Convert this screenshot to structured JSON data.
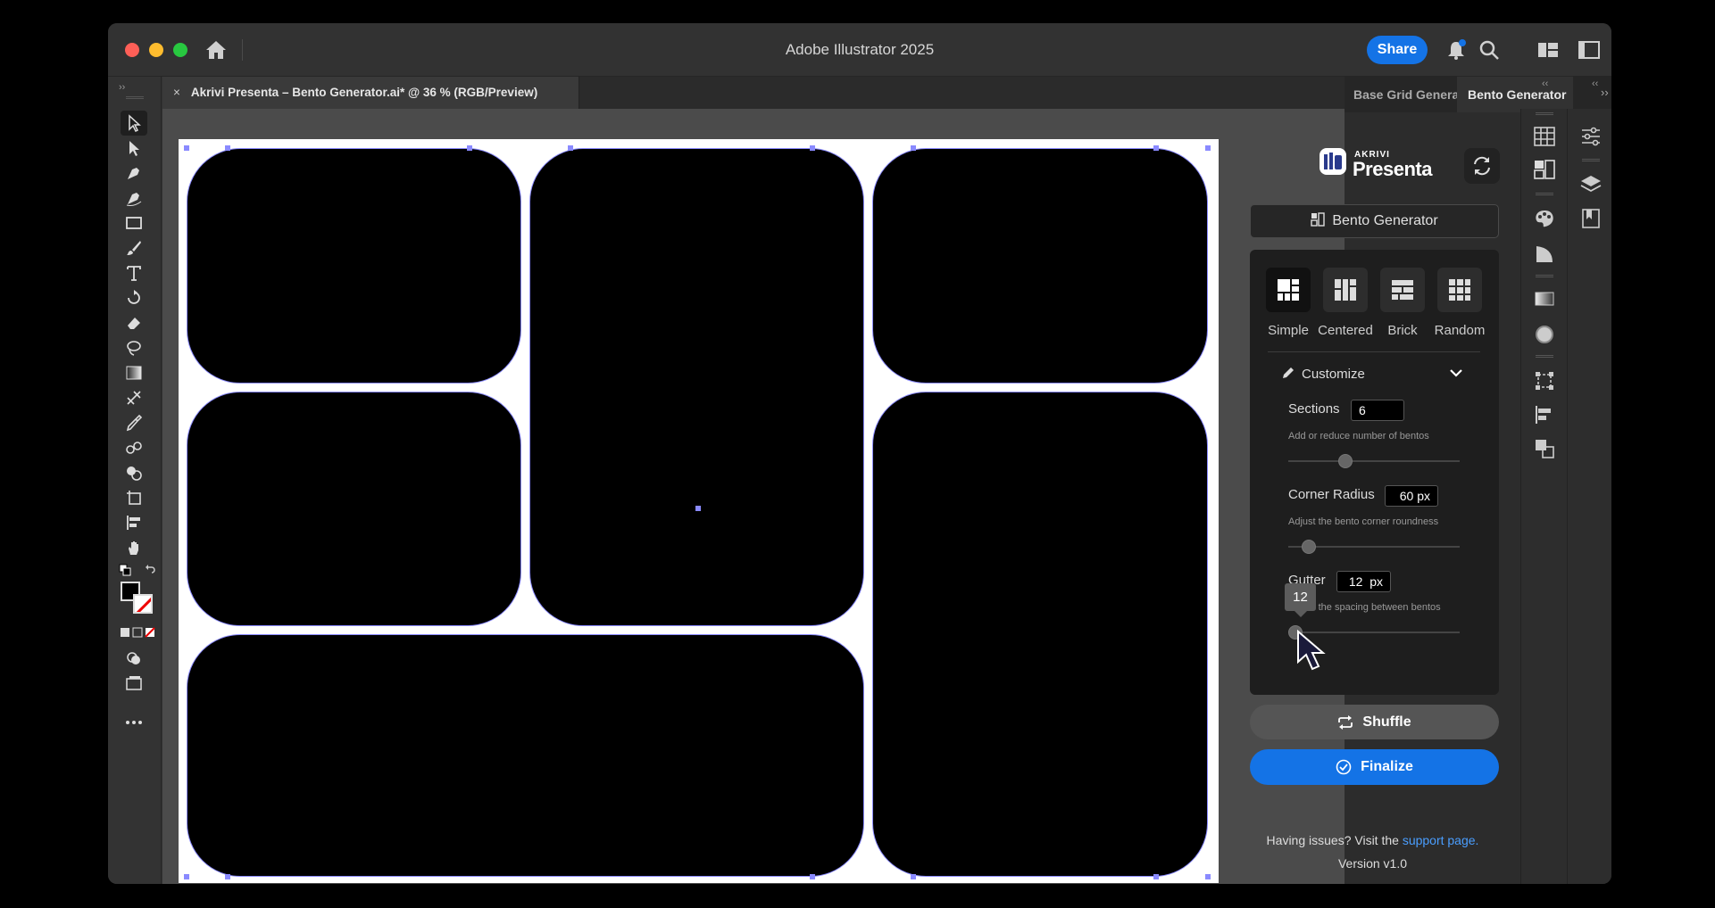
{
  "app": {
    "title": "Adobe Illustrator 2025",
    "share_label": "Share"
  },
  "document": {
    "tab_title": "Akrivi Presenta – Bento Generator.ai* @ 36 % (RGB/Preview)",
    "close": "×"
  },
  "panel": {
    "tabs": [
      {
        "label": "Base Grid Generator"
      },
      {
        "label": "Bento Generator"
      }
    ],
    "logo_top": "AKRIVI",
    "logo_main": "Presenta",
    "bento_button_label": "Bento Generator",
    "layouts": [
      {
        "label": "Simple",
        "selected": true
      },
      {
        "label": "Centered",
        "selected": false
      },
      {
        "label": "Brick",
        "selected": false
      },
      {
        "label": "Random",
        "selected": false
      }
    ],
    "customize_label": "Customize",
    "sections": {
      "label": "Sections",
      "value": "6",
      "hint": "Add or reduce number of bentos"
    },
    "corner_radius": {
      "label": "Corner Radius",
      "value": "60 px",
      "hint": "Adjust the bento corner roundness"
    },
    "gutter": {
      "label": "Gutter",
      "value": "12  px",
      "hint": "Adjust the spacing between bentos",
      "tooltip": "12"
    },
    "shuffle_label": "Shuffle",
    "finalize_label": "Finalize",
    "issues_text": "Having issues? Visit the ",
    "support_link": "support page.",
    "version": "Version v1.0"
  },
  "colors": {
    "accent": "#1473e6",
    "selection": "#8a8aff",
    "bento": "#000000",
    "artboard": "#ffffff"
  }
}
